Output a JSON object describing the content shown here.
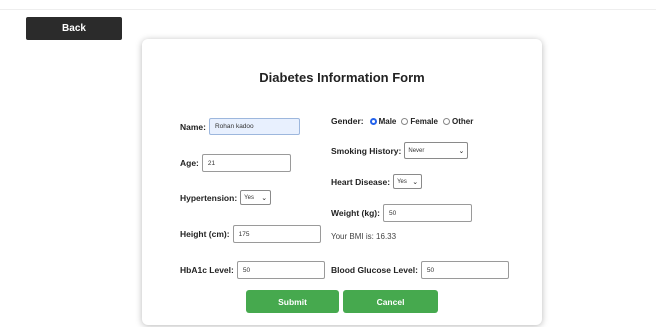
{
  "nav": {
    "back_label": "Back"
  },
  "form": {
    "title": "Diabetes Information Form",
    "name": {
      "label": "Name:",
      "value": "Rohan kadoo"
    },
    "gender": {
      "label": "Gender:",
      "options": [
        "Male",
        "Female",
        "Other"
      ],
      "selected": "Male"
    },
    "age": {
      "label": "Age:",
      "value": "21"
    },
    "smoking_history": {
      "label": "Smoking History:",
      "value": "Never"
    },
    "hypertension": {
      "label": "Hypertension:",
      "value": "Yes"
    },
    "heart_disease": {
      "label": "Heart Disease:",
      "value": "Yes"
    },
    "weight": {
      "label": "Weight (kg):",
      "value": "50"
    },
    "height": {
      "label": "Height (cm):",
      "value": "175"
    },
    "bmi_text": "Your BMI is: 16.33",
    "hba1c": {
      "label": "HbA1c Level:",
      "value": "50"
    },
    "blood_glucose": {
      "label": "Blood Glucose Level:",
      "value": "50"
    },
    "submit_label": "Submit",
    "cancel_label": "Cancel"
  },
  "colors": {
    "accent_green": "#46a94e",
    "back_button": "#2b2b2b",
    "radio_selected": "#2563eb",
    "autofill_bg": "#e8f0fe"
  },
  "icons": {
    "dropdown": "chevron-down-icon"
  }
}
